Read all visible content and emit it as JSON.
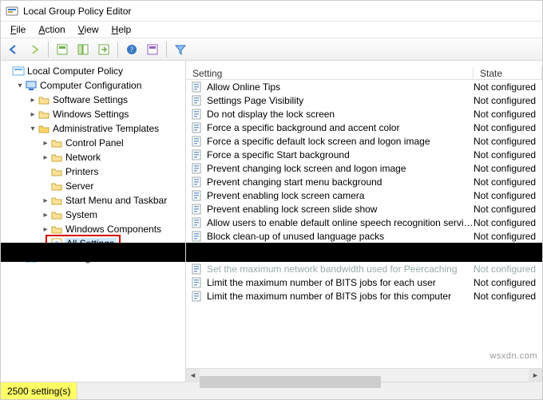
{
  "window": {
    "title": "Local Group Policy Editor"
  },
  "menu": {
    "file": {
      "label": "File",
      "mn": "F"
    },
    "action": {
      "label": "Action",
      "mn": "A"
    },
    "view": {
      "label": "View",
      "mn": "V"
    },
    "help": {
      "label": "Help",
      "mn": "H"
    }
  },
  "tree": {
    "root": "Local Computer Policy",
    "computer_configuration": "Computer Configuration",
    "software_settings": "Software Settings",
    "windows_settings": "Windows Settings",
    "administrative_templates": "Administrative Templates",
    "control_panel": "Control Panel",
    "network": "Network",
    "printers": "Printers",
    "server": "Server",
    "start_menu_taskbar": "Start Menu and Taskbar",
    "system": "System",
    "windows_components": "Windows Components",
    "all_settings": "All Settings",
    "user_configuration": "User Configuration"
  },
  "list": {
    "header_setting": "Setting",
    "header_state": "State",
    "not_configured": "Not configured",
    "rows_top": [
      "Allow Online Tips",
      "Settings Page Visibility",
      "Do not display the lock screen",
      "Force a specific background and accent color",
      "Force a specific default lock screen and logon image",
      "Force a specific Start background",
      "Prevent changing lock screen and logon image",
      "Prevent changing start menu background",
      "Prevent enabling lock screen camera",
      "Prevent enabling lock screen slide show",
      "Allow users to enable default online speech recognition services",
      "Block clean-up of unused language packs"
    ],
    "rows_bottom_cut": "Set the maximum network bandwidth used for Peercaching",
    "rows_bottom": [
      "Limit the maximum number of BITS jobs for each user",
      "Limit the maximum number of BITS jobs for this computer"
    ]
  },
  "status": {
    "count_text": "2500 setting(s)"
  },
  "watermark": "wsxdn.com"
}
